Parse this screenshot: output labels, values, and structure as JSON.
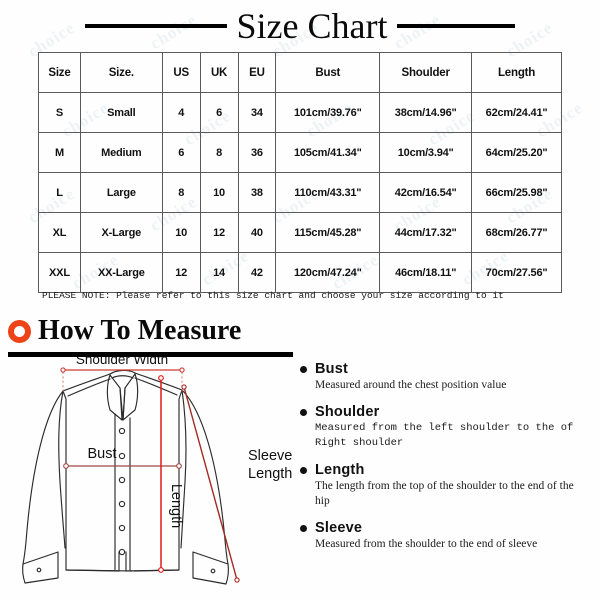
{
  "header": {
    "title": "Size Chart",
    "rule_color": "#000000"
  },
  "table": {
    "columns": [
      "Size",
      "Size.",
      "US",
      "UK",
      "EU",
      "Bust",
      "Shoulder",
      "Length"
    ],
    "rows": [
      {
        "size": "S",
        "size_name": "Small",
        "us": "4",
        "uk": "6",
        "eu": "34",
        "bust": "101cm/39.76\"",
        "shoulder": "38cm/14.96\"",
        "length": "62cm/24.41\""
      },
      {
        "size": "M",
        "size_name": "Medium",
        "us": "6",
        "uk": "8",
        "eu": "36",
        "bust": "105cm/41.34\"",
        "shoulder": "10cm/3.94\"",
        "length": "64cm/25.20\""
      },
      {
        "size": "L",
        "size_name": "Large",
        "us": "8",
        "uk": "10",
        "eu": "38",
        "bust": "110cm/43.31\"",
        "shoulder": "42cm/16.54\"",
        "length": "66cm/25.98\""
      },
      {
        "size": "XL",
        "size_name": "X-Large",
        "us": "10",
        "uk": "12",
        "eu": "40",
        "bust": "115cm/45.28\"",
        "shoulder": "44cm/17.32\"",
        "length": "68cm/26.77\""
      },
      {
        "size": "XXL",
        "size_name": "XX-Large",
        "us": "12",
        "uk": "14",
        "eu": "42",
        "bust": "120cm/47.24\"",
        "shoulder": "46cm/18.11\"",
        "length": "70cm/27.56\""
      }
    ]
  },
  "note": "PLEASE NOTE: Please refer to this size chart and choose your size according to it",
  "how_to_measure": {
    "heading": "How To Measure",
    "ring_color": "#ee4217",
    "definitions": [
      {
        "title": "Bust",
        "desc": "Measured around the chest position value"
      },
      {
        "title": "Shoulder",
        "desc": "Measured from the left shoulder to the of Right shoulder"
      },
      {
        "title": "Length",
        "desc": "The length from the top of the shoulder to the end of the hip"
      },
      {
        "title": "Sleeve",
        "desc": "Measured from the shoulder to the end of sleeve"
      }
    ]
  },
  "illustration": {
    "garment": "long-sleeve-shirt",
    "labels": {
      "shoulder_width": "Shoulder Width",
      "bust": "Bust",
      "length": "Length",
      "sleeve_length_line1": "Sleeve",
      "sleeve_length_line2": "Length"
    },
    "colors": {
      "outline": "#2b2b2b",
      "bust_line": "#9c4a44",
      "length_line": "#e01b1b",
      "sleeve_line": "#a32a22",
      "shoulder_line": "#d03b33",
      "guide_dash": "#c26d66"
    },
    "button_count": 6
  },
  "watermark": {
    "text": "choice",
    "color": "rgba(170,195,210,0.20)"
  }
}
